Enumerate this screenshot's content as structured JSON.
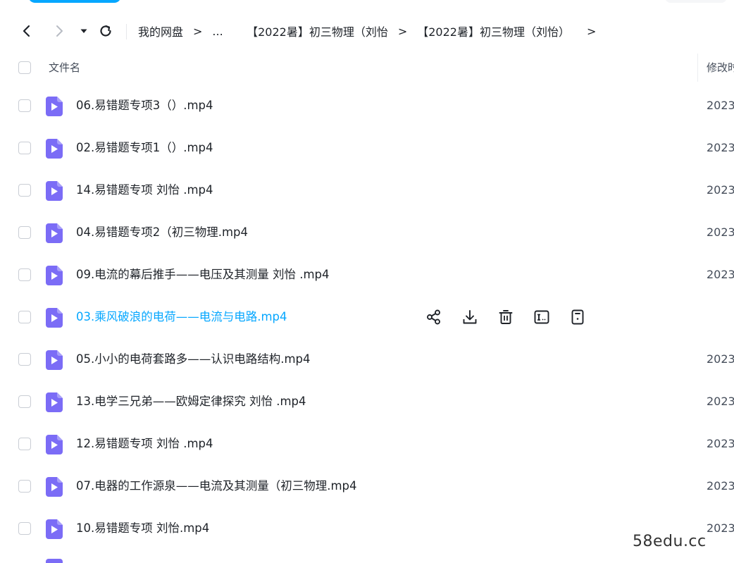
{
  "breadcrumb": {
    "root": "我的网盘",
    "ellipsis": "...",
    "parent": "【2022暑】初三物理（刘怡",
    "current": "【2022暑】初三物理（刘怡）",
    "separator": ">"
  },
  "header": {
    "name_label": "文件名",
    "date_label": "修改时间"
  },
  "files": [
    {
      "name": "06.易错题专项3（）.mp4",
      "date": "2023"
    },
    {
      "name": "02.易错题专项1（）.mp4",
      "date": "2023"
    },
    {
      "name": "14.易错题专项 刘怡 .mp4",
      "date": "2023"
    },
    {
      "name": "04.易错题专项2（初三物理.mp4",
      "date": "2023"
    },
    {
      "name": "09.电流的幕后推手——电压及其测量 刘怡 .mp4",
      "date": "2023"
    },
    {
      "name": "03.乘风破浪的电荷——电流与电路.mp4",
      "date": ""
    },
    {
      "name": "05.小小的电荷套路多——认识电路结构.mp4",
      "date": "2023"
    },
    {
      "name": "13.电学三兄弟——欧姆定律探究 刘怡 .mp4",
      "date": "2023"
    },
    {
      "name": "12.易错题专项 刘怡 .mp4",
      "date": "2023"
    },
    {
      "name": "07.电器的工作源泉——电流及其测量（初三物理.mp4",
      "date": "2023"
    },
    {
      "name": "10.易错题专项  刘怡.mp4",
      "date": "2023"
    }
  ],
  "hovered_row_actions": [
    "share-icon",
    "download-icon",
    "delete-icon",
    "rename-icon",
    "more-icon"
  ],
  "watermark": "58edu.cc",
  "colors": {
    "accent": "#06a7ff",
    "file_icon": "#7b6cf6",
    "text": "#1f2329",
    "muted": "#454d5a"
  }
}
